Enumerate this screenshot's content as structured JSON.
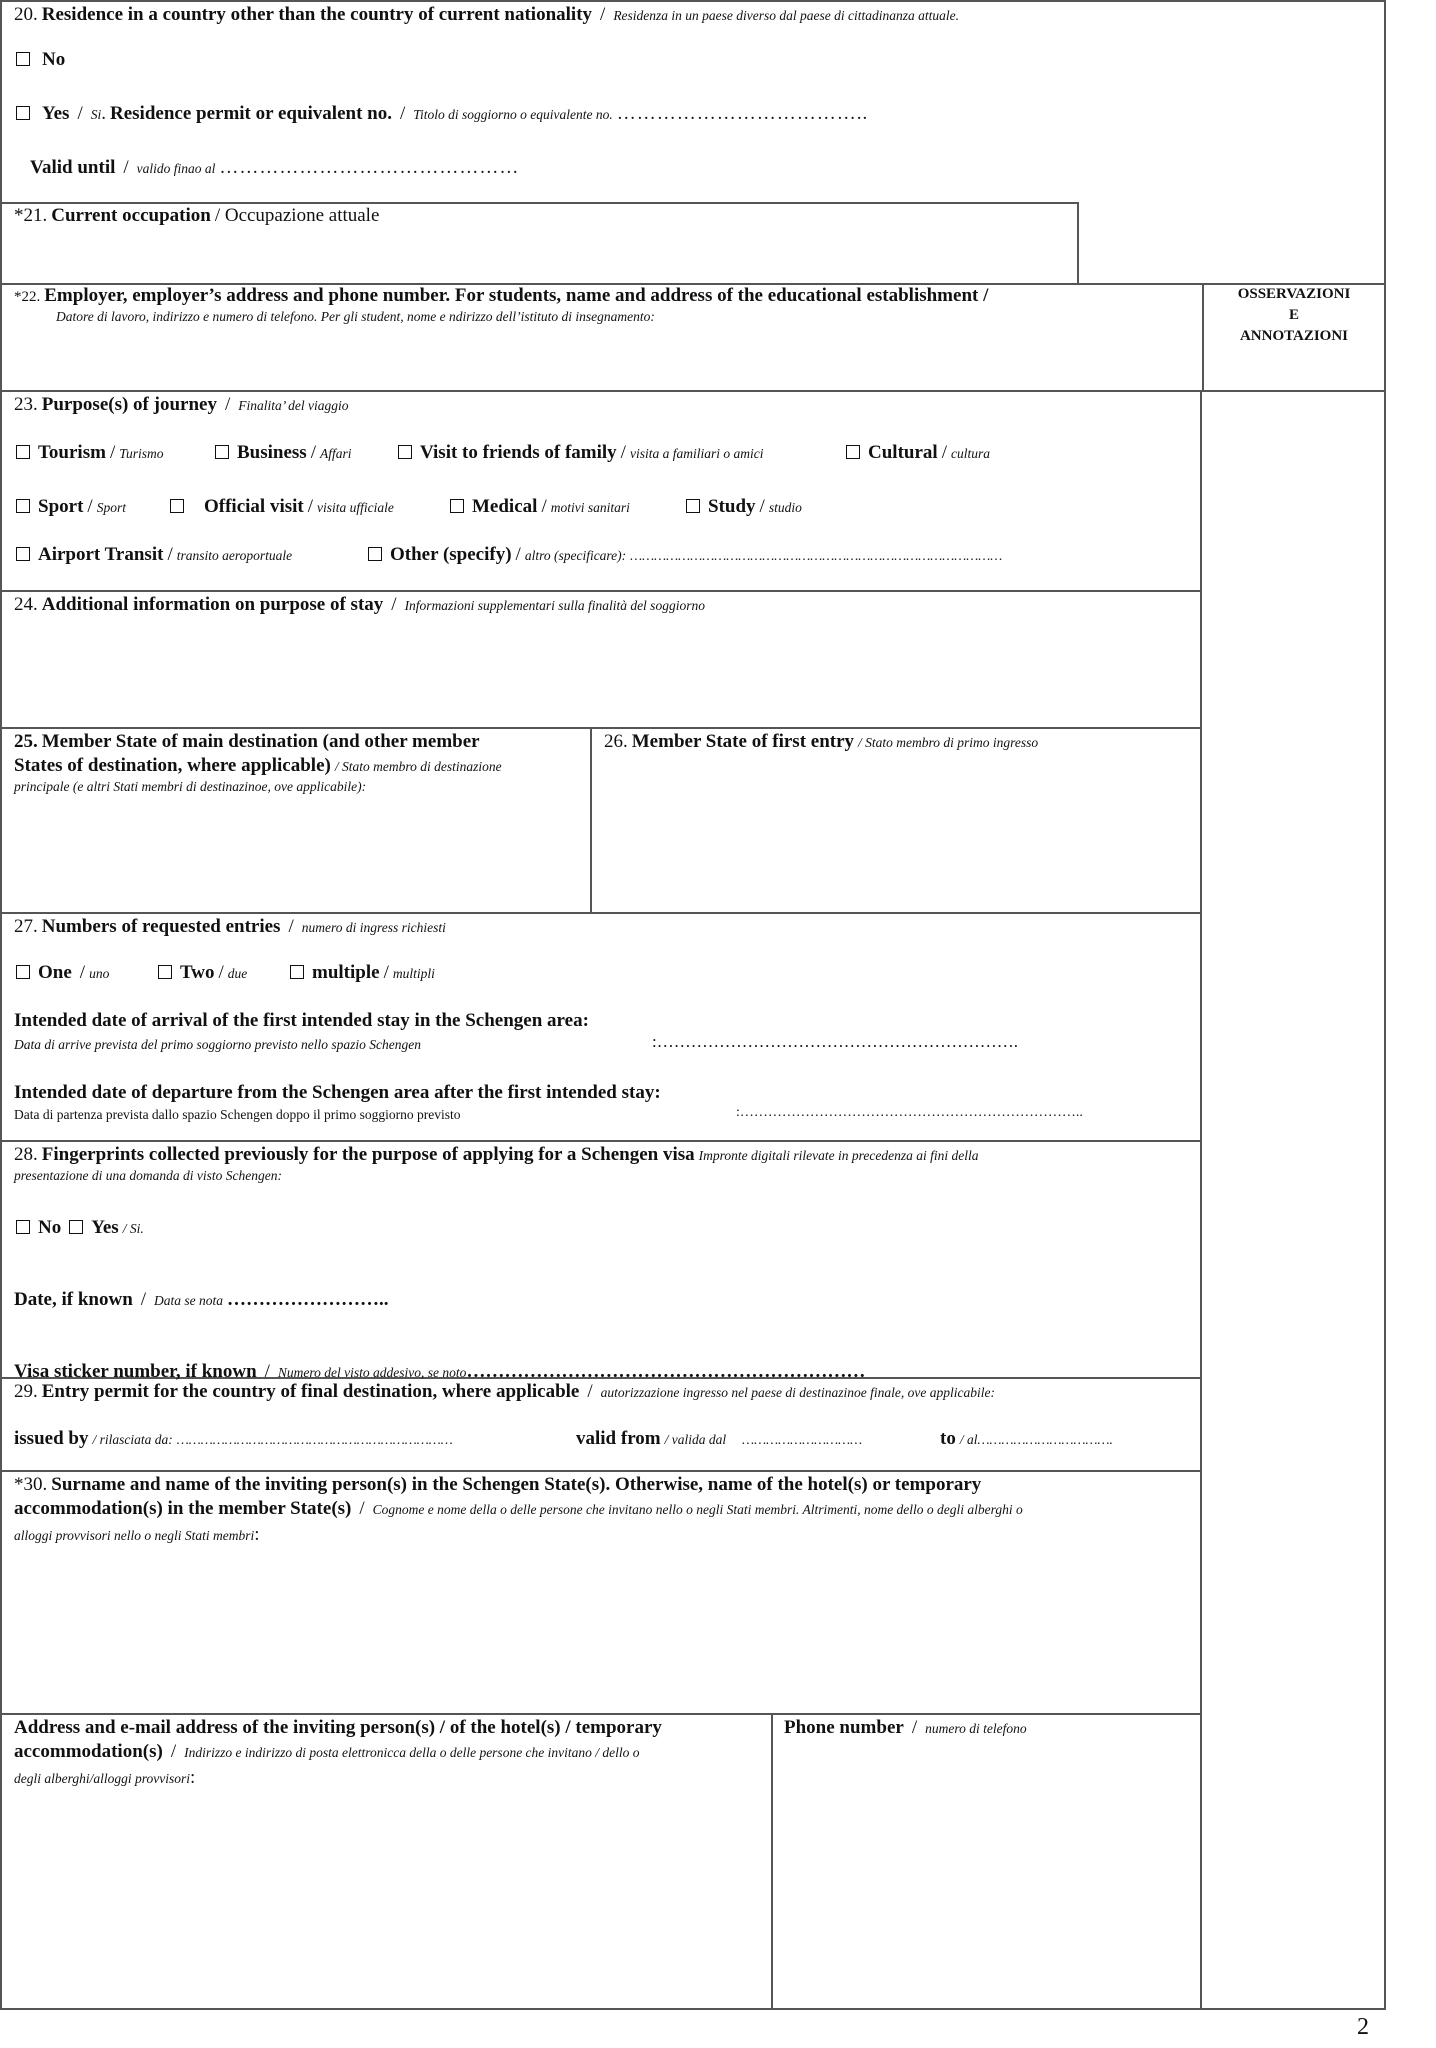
{
  "page_number": "2",
  "annotations_column": {
    "heading_lines": [
      "OSSERVAZIONI",
      "E",
      "ANNOTAZIONI"
    ]
  },
  "section20": {
    "num": "20.",
    "title": "Residence in a country other than the country of current nationality",
    "title_it": "Residenza in un paese diverso dal paese di cittadinanza attuale.",
    "options": [
      {
        "label": "No",
        "checked": false
      },
      {
        "label": "Yes",
        "label_it": "Si",
        "checked": false
      }
    ],
    "permit_label": "Residence permit or equivalent no.",
    "permit_label_it": "Titolo di soggiorno o equivalente no.",
    "permit_value": "",
    "permit_dots": "………………………………..",
    "valid_until_label": "Valid until",
    "valid_until_label_it": "valido finao al",
    "valid_until_value": "",
    "valid_until_dots": "………………………………………"
  },
  "section21": {
    "num": "*21.",
    "title": "Current occupation",
    "title_it": "Occupazione attuale",
    "value": ""
  },
  "section22": {
    "num": "*22.",
    "title": "Employer, employer’s address and phone number. For students, name and address of the educational establishment /",
    "title_it": "Datore di lavoro, indirizzo e numero di telefono. Per gli student, nome e ndirizzo dell’istituto di insegnamento:",
    "value": ""
  },
  "section23": {
    "num": "23.",
    "title": "Purpose(s) of journey",
    "title_it": "Finalita’ del viaggio",
    "options": [
      {
        "label": "Tourism",
        "label_it": "Turismo",
        "checked": false
      },
      {
        "label": "Business",
        "label_it": "Affari",
        "checked": false
      },
      {
        "label": "Visit to friends of family",
        "label_it": "visita a familiari o  amici",
        "checked": false
      },
      {
        "label": "Cultural",
        "label_it": "cultura",
        "checked": false
      },
      {
        "label": "Sport",
        "label_it": "Sport",
        "checked": false
      },
      {
        "label": "Official visit",
        "label_it": "visita ufficiale",
        "checked": false
      },
      {
        "label": "Medical",
        "label_it": "motivi sanitari",
        "checked": false
      },
      {
        "label": "Study",
        "label_it": "studio",
        "checked": false
      },
      {
        "label": "Airport Transit",
        "label_it": "transito aeroportuale",
        "checked": false
      },
      {
        "label": "Other (specify)",
        "label_it": "altro (specificare):",
        "checked": false
      }
    ],
    "other_dots": "…………………………………………………………………………………",
    "other_value": ""
  },
  "section24": {
    "num": "24.",
    "title": "Additional information on purpose of stay",
    "title_it": "Informazioni supplementari sulla finalità del soggiorno",
    "value": ""
  },
  "section25": {
    "num": "25.",
    "title_line1": "Member State of main destination (and other member",
    "title_line2": "States of destination, where applicable)",
    "title_it_a": "/ Stato membro di destinazione",
    "title_it_b": "principale (e altri Stati membri di destinazinoe, ove applicabile):",
    "value": ""
  },
  "section26": {
    "num": "26.",
    "title": "Member State of first entry",
    "title_it": "/ Stato membro di primo ingresso",
    "value": ""
  },
  "section27": {
    "num": "27.",
    "title": "Numbers of requested entries",
    "title_it": "numero di ingress richiesti",
    "options": [
      {
        "label": "One",
        "label_it": "uno",
        "checked": false
      },
      {
        "label": "Two",
        "label_it": "due",
        "checked": false
      },
      {
        "label": "multiple",
        "label_it": "multipli",
        "checked": false
      }
    ],
    "arrival_label": "Intended date of arrival of the first intended stay in the Schengen area:",
    "arrival_label_it": "Data di arrive prevista del primo soggiorno previsto nello spazio Schengen",
    "arrival_dots": ":……………………………………………………….",
    "arrival_value": "",
    "departure_label": "Intended date of departure from the Schengen area after the first intended stay:",
    "departure_label_it": "Data di partenza prevista dallo spazio Schengen doppo il primo soggiorno previsto",
    "departure_dots": ":………………………………………………………………..",
    "departure_value": ""
  },
  "section28": {
    "num": "28.",
    "title": "Fingerprints collected previously for the purpose of applying for a Schengen visa",
    "title_it_a": "Impronte digitali rilevate in precedenza ai fini della",
    "title_it_b": "presentazione di una domanda di visto Schengen:",
    "options": [
      {
        "label": "No",
        "checked": false
      },
      {
        "label": "Yes",
        "label_it": "/ Si.",
        "checked": false
      }
    ],
    "date_label": "Date, if known",
    "date_label_it": "Data se nota",
    "date_dots": "……………………..",
    "date_value": "",
    "sticker_label": "Visa sticker number, if known",
    "sticker_label_it": "Numero del visto addesivo, se noto",
    "sticker_dots": "………………………………………………………",
    "sticker_value": ""
  },
  "section29": {
    "num": "29.",
    "title": "Entry permit for the country of final destination, where applicable",
    "title_it": "autorizzazione ingresso nel paese di destinazinoe finale, ove applicabile:",
    "issued_by_label": "issued by",
    "issued_by_label_it": "/ rilasciata da:",
    "issued_by_dots": "……………………………………………………………",
    "issued_by_value": "",
    "valid_from_label": "valid from",
    "valid_from_label_it": "/ valida dal",
    "valid_from_dots": "…………………………",
    "valid_from_value": "",
    "to_label": "to",
    "to_label_it": "/ al",
    "to_dots": "…………………………….",
    "to_value": ""
  },
  "section30": {
    "num": "*30.",
    "title_line1": "Surname and name of the inviting person(s) in the Schengen State(s). Otherwise, name of the hotel(s) or temporary",
    "title_line2": "accommodation(s) in the member State(s)",
    "title_it_a": "Cognome e nome della o delle persone che invitano nello o negli Stati membri. Altrimenti, nome dello o degli alberghi o",
    "title_it_b": "alloggi provvisori nello o negli Stati membri",
    "value": ""
  },
  "address": {
    "title_line1": "Address and e-mail address of the inviting person(s) / of the hotel(s) / temporary",
    "title_line2": "accommodation(s)",
    "title_it_a": "Indirizzo e indirizzo di posta elettronicca della o delle persone che invitano / dello o",
    "title_it_b": "degli alberghi/alloggi provvisori",
    "value": ""
  },
  "phone": {
    "title": "Phone number",
    "title_it": "numero di telefono",
    "value": ""
  }
}
